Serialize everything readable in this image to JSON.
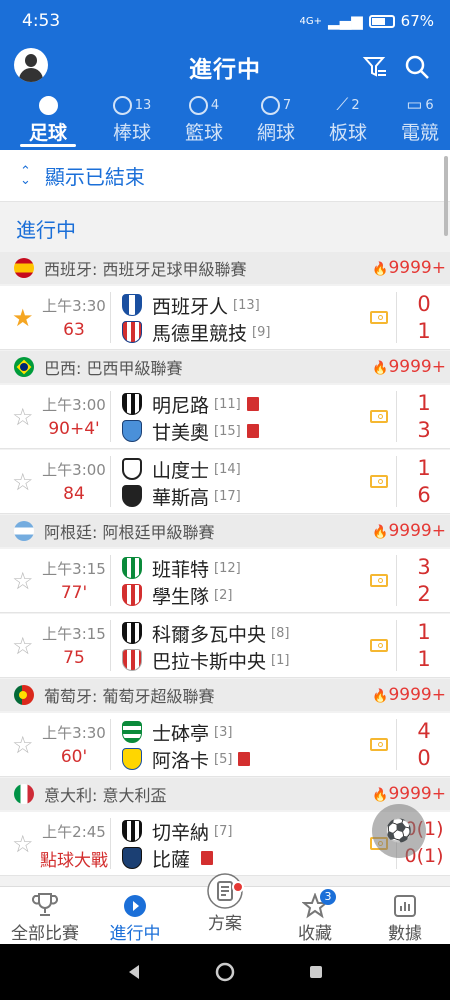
{
  "status_bar": {
    "time": "4:53",
    "battery": "67%",
    "network": "4G+"
  },
  "app_bar": {
    "title": "進行中"
  },
  "sport_tabs": [
    {
      "label": "足球",
      "count": "",
      "icon": "soccer-icon",
      "active": true
    },
    {
      "label": "棒球",
      "count": "13",
      "icon": "baseball-icon",
      "active": false
    },
    {
      "label": "籃球",
      "count": "4",
      "icon": "basketball-icon",
      "active": false
    },
    {
      "label": "網球",
      "count": "7",
      "icon": "tennis-icon",
      "active": false
    },
    {
      "label": "板球",
      "count": "2",
      "icon": "cricket-icon",
      "active": false
    },
    {
      "label": "電競",
      "count": "6",
      "icon": "gamepad-icon",
      "active": false
    }
  ],
  "show_finished": "顯示已結束",
  "section_title": "進行中",
  "leagues": [
    {
      "name": "西班牙: 西班牙足球甲級聯賽",
      "hot": "9999+",
      "flag": "spain",
      "matches": [
        {
          "fav": true,
          "time": "上午3:30",
          "minute": "63",
          "home": "西班牙人",
          "home_rank": "[13]",
          "away": "馬德里競技",
          "away_rank": "[9]",
          "home_score": "0",
          "away_score": "1",
          "home_red": false,
          "away_red": false
        }
      ]
    },
    {
      "name": "巴西: 巴西甲級聯賽",
      "hot": "9999+",
      "flag": "brazil",
      "matches": [
        {
          "fav": false,
          "time": "上午3:00",
          "minute": "90+4'",
          "home": "明尼路",
          "home_rank": "[11]",
          "away": "甘美奧",
          "away_rank": "[15]",
          "home_score": "1",
          "away_score": "3",
          "home_red": true,
          "away_red": true
        },
        {
          "fav": false,
          "time": "上午3:00",
          "minute": "84",
          "home": "山度士",
          "home_rank": "[14]",
          "away": "華斯高",
          "away_rank": "[17]",
          "home_score": "1",
          "away_score": "6",
          "home_red": false,
          "away_red": false
        }
      ]
    },
    {
      "name": "阿根廷: 阿根廷甲級聯賽",
      "hot": "9999+",
      "flag": "argentina",
      "matches": [
        {
          "fav": false,
          "time": "上午3:15",
          "minute": "77'",
          "home": "班菲特",
          "home_rank": "[12]",
          "away": "學生隊",
          "away_rank": "[2]",
          "home_score": "3",
          "away_score": "2",
          "home_red": false,
          "away_red": false
        },
        {
          "fav": false,
          "time": "上午3:15",
          "minute": "75",
          "home": "科爾多瓦中央",
          "home_rank": "[8]",
          "away": "巴拉卡斯中央",
          "away_rank": "[1]",
          "home_score": "1",
          "away_score": "1",
          "home_red": false,
          "away_red": false
        }
      ]
    },
    {
      "name": "葡萄牙: 葡萄牙超級聯賽",
      "hot": "9999+",
      "flag": "portugal",
      "matches": [
        {
          "fav": false,
          "time": "上午3:30",
          "minute": "60'",
          "home": "士砵亭",
          "home_rank": "[3]",
          "away": "阿洛卡",
          "away_rank": "[5]",
          "home_score": "4",
          "away_score": "0",
          "home_red": false,
          "away_red": true
        }
      ]
    },
    {
      "name": "意大利: 意大利盃",
      "hot": "9999+",
      "flag": "italy",
      "matches": [
        {
          "fav": false,
          "time": "上午2:45",
          "minute": "點球大戰",
          "home": "切辛納",
          "home_rank": "[7]",
          "away": "比薩",
          "away_rank": "",
          "home_score": "0(1)",
          "away_score": "0(1)",
          "home_red": false,
          "away_red": true
        }
      ]
    }
  ],
  "bottom_nav": [
    {
      "label": "全部比賽",
      "icon": "trophy-icon",
      "active": false,
      "badge": ""
    },
    {
      "label": "進行中",
      "icon": "play-icon",
      "active": true,
      "badge": ""
    },
    {
      "label": "方案",
      "icon": "document-icon",
      "active": false,
      "badge": "dot"
    },
    {
      "label": "收藏",
      "icon": "star-icon",
      "active": false,
      "badge": "3"
    },
    {
      "label": "數據",
      "icon": "bar-chart-icon",
      "active": false,
      "badge": ""
    }
  ],
  "colors": {
    "primary": "#1b6fd8",
    "live": "#d32f2f",
    "favorite": "#f5a623",
    "hot": "#e53935"
  }
}
